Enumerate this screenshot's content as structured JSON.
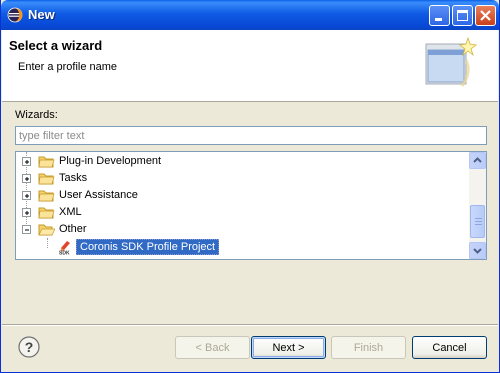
{
  "window": {
    "title": "New"
  },
  "header": {
    "title": "Select a wizard",
    "subtitle": "Enter a profile name"
  },
  "wizards": {
    "label": "Wizards:",
    "filter_placeholder": "type filter text",
    "filter_value": ""
  },
  "tree": {
    "items": [
      {
        "label": "Plug-in Development",
        "expanded": false
      },
      {
        "label": "Tasks",
        "expanded": false
      },
      {
        "label": "User Assistance",
        "expanded": false
      },
      {
        "label": "XML",
        "expanded": false
      },
      {
        "label": "Other",
        "expanded": true
      }
    ],
    "selected_child": {
      "label": "Coronis SDK Profile Project",
      "icon": "sdk-icon"
    }
  },
  "buttons": {
    "back": "< Back",
    "next": "Next >",
    "finish": "Finish",
    "cancel": "Cancel"
  },
  "colors": {
    "titlebar": "#0a5fe8",
    "selection": "#316ac5",
    "dialog_bg": "#ece9d8"
  }
}
